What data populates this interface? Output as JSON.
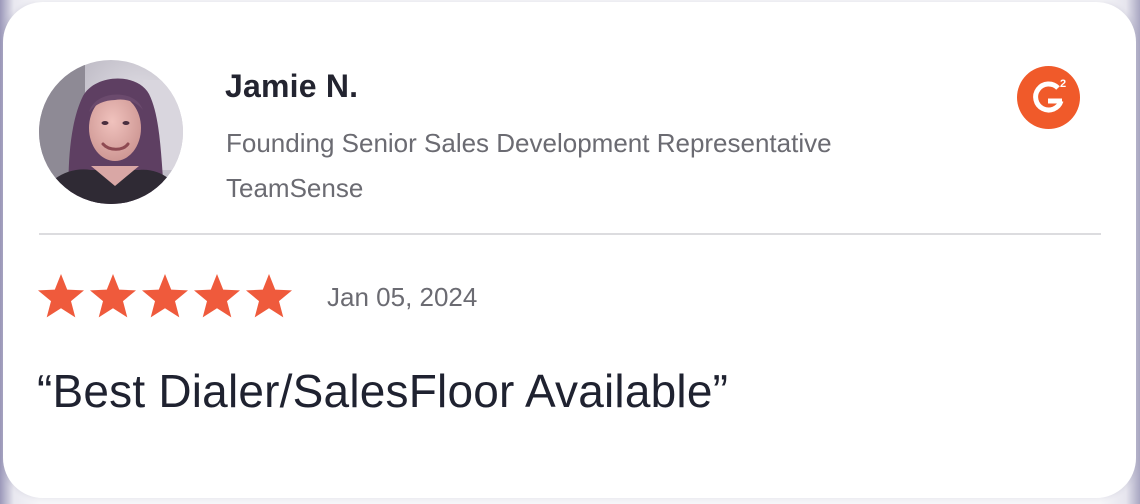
{
  "reviewer": {
    "name": "Jamie N.",
    "job_title": "Founding Senior Sales Development Representative",
    "company": "TeamSense",
    "avatar_icon": "reviewer-photo"
  },
  "source": {
    "logo_icon": "g2-logo-icon",
    "logo_letter": "G",
    "logo_superscript": "2",
    "brand_color": "#f05a2a"
  },
  "review": {
    "rating": 5,
    "rating_max": 5,
    "star_color": "#ef5a3c",
    "date": "Jan 05, 2024",
    "title": "“Best Dialer/SalesFloor Available”"
  },
  "colors": {
    "card_background": "#ffffff",
    "name_text": "#232430",
    "secondary_text": "#6b6b72",
    "divider": "#dcdcdf"
  }
}
